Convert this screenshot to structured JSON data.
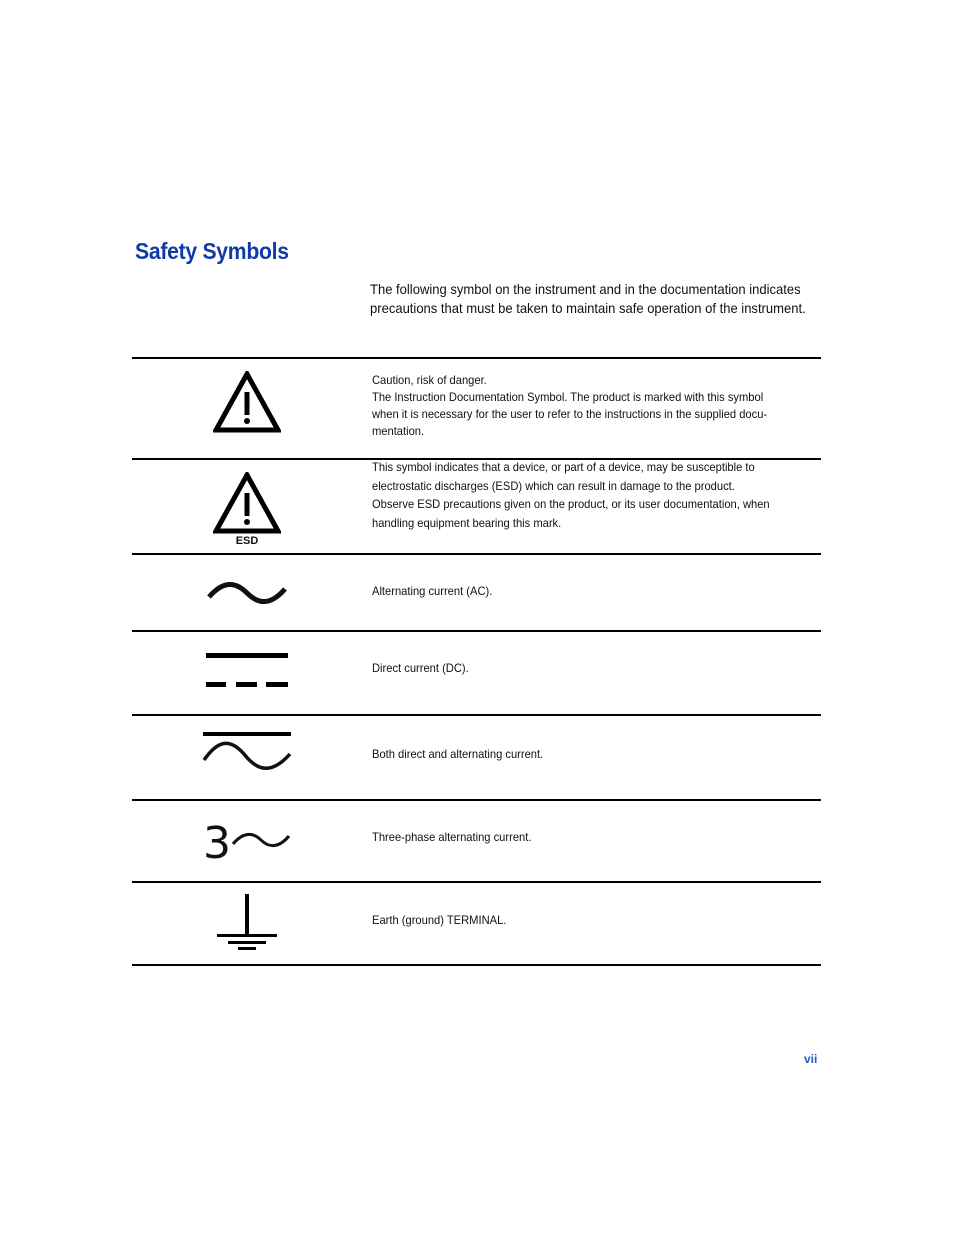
{
  "page": {
    "title": "Safety Symbols",
    "intro": "The following symbol on the instrument and in the documentation indicates precautions that must be taken to maintain safe operation of the instrument.",
    "page_number": "vii"
  },
  "symbols": [
    {
      "icon": "warning-triangle-icon",
      "lines": [
        "Caution, risk of danger.",
        "The Instruction Documentation Symbol. The product is marked with this symbol",
        "when it is necessary for the user to refer to the instructions in the supplied docu-",
        "mentation."
      ]
    },
    {
      "icon": "esd-warning-icon",
      "icon_label": "ESD",
      "lines": [
        "This symbol indicates that a device, or part of a device, may be susceptible to",
        "electrostatic discharges (ESD) which can result in damage to the product.",
        "Observe ESD precautions given on the product, or its user documentation, when",
        "handling equipment bearing this mark."
      ]
    },
    {
      "icon": "alternating-current-icon",
      "lines": [
        "Alternating current (AC)."
      ]
    },
    {
      "icon": "direct-current-icon",
      "lines": [
        "Direct current (DC)."
      ]
    },
    {
      "icon": "ac-dc-icon",
      "lines": [
        "Both direct and alternating current."
      ]
    },
    {
      "icon": "three-phase-ac-icon",
      "icon_label": "3",
      "lines": [
        "Three-phase alternating current."
      ]
    },
    {
      "icon": "earth-ground-icon",
      "lines": [
        "Earth (ground) TERMINAL."
      ]
    }
  ]
}
